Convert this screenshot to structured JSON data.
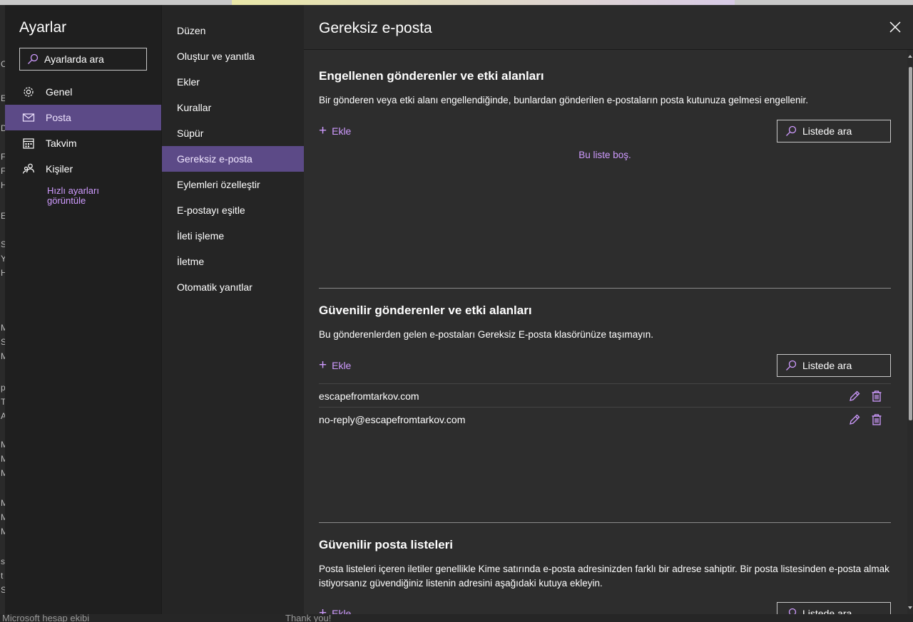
{
  "colors": {
    "accent": "#cf9bff",
    "selected_bg": "#5c4a87"
  },
  "background": {
    "left_letters": [
      "C",
      "E",
      "D",
      "F",
      "F",
      "H",
      "E",
      "S",
      "Y",
      "H",
      "M",
      "S",
      "M",
      "p",
      "T",
      "A",
      "M",
      "M",
      "M",
      "M",
      "M",
      "M",
      "s",
      "t",
      "S"
    ],
    "bottom_left_text": "Microsoft hesap ekibi",
    "bottom_mid_text": "Thank  you!"
  },
  "settings": {
    "title": "Ayarlar",
    "search_placeholder": "Ayarlarda ara",
    "categories": [
      {
        "label": "Genel",
        "icon": "gear-icon"
      },
      {
        "label": "Posta",
        "icon": "mail-icon"
      },
      {
        "label": "Takvim",
        "icon": "calendar-icon"
      },
      {
        "label": "Kişiler",
        "icon": "people-icon"
      }
    ],
    "selected_category": "Posta",
    "quick_settings_link": "Hızlı ayarları görüntüle"
  },
  "mail_nav": {
    "items": [
      "Düzen",
      "Oluştur ve yanıtla",
      "Ekler",
      "Kurallar",
      "Süpür",
      "Gereksiz e-posta",
      "Eylemleri özelleştir",
      "E-postayı eşitle",
      "İleti işleme",
      "İletme",
      "Otomatik yanıtlar"
    ],
    "selected": "Gereksiz e-posta"
  },
  "main": {
    "title": "Gereksiz e-posta",
    "blocked": {
      "title": "Engellenen gönderenler ve etki alanları",
      "description": "Bir gönderen veya etki alanı engellendiğinde, bunlardan gönderilen e-postaların posta kutunuza gelmesi engellenir.",
      "add_label": "Ekle",
      "search_label": "Listede ara",
      "empty_text": "Bu liste boş."
    },
    "safe": {
      "title": "Güvenilir gönderenler ve etki alanları",
      "description": "Bu gönderenlerden gelen e-postaları Gereksiz E-posta klasörünüze taşımayın.",
      "add_label": "Ekle",
      "search_label": "Listede ara",
      "entries": [
        "escapefromtarkov.com",
        "no-reply@escapefromtarkov.com"
      ]
    },
    "mailing_lists": {
      "title": "Güvenilir posta listeleri",
      "description": "Posta listeleri içeren iletiler genellikle Kime satırında e-posta adresinizden farklı bir adrese sahiptir. Bir posta listesinden e-posta almak istiyorsanız güvendiğiniz listenin adresini aşağıdaki kutuya ekleyin.",
      "add_label": "Ekle",
      "search_label": "Listede ara"
    }
  }
}
